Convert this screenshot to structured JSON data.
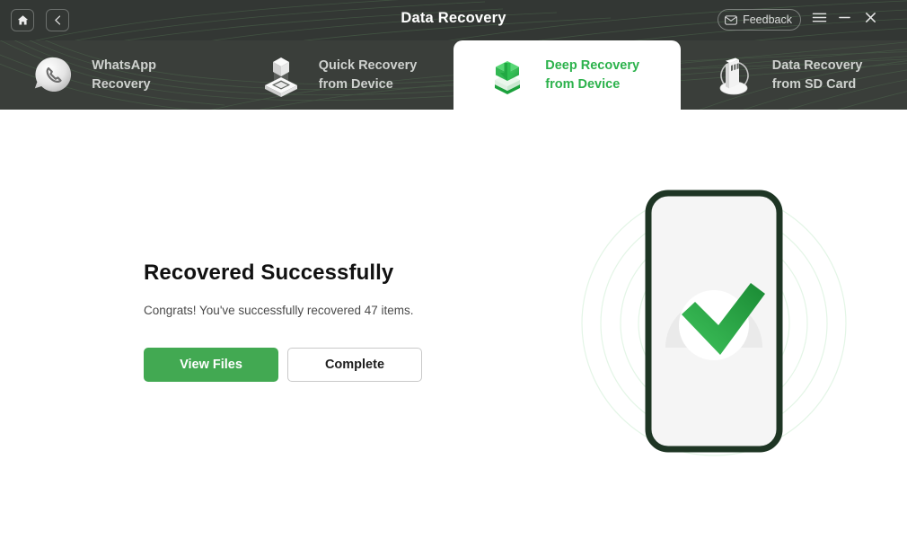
{
  "window": {
    "title": "Data Recovery",
    "home_icon": "home-icon",
    "back_icon": "chevron-left-icon",
    "feedback_label": "Feedback",
    "feedback_icon": "envelope-icon",
    "menu_icon": "hamburger-menu-icon",
    "minimize_icon": "minimize-icon",
    "close_icon": "close-icon"
  },
  "tabs": [
    {
      "id": "whatsapp-recovery",
      "label": "WhatsApp\nRecovery",
      "icon": "whatsapp-bubble-icon",
      "active": false
    },
    {
      "id": "quick-recovery-from-device",
      "label": "Quick Recovery\nfrom Device",
      "icon": "cube-platform-icon",
      "active": false
    },
    {
      "id": "deep-recovery-from-device",
      "label": "Deep Recovery\nfrom Device",
      "icon": "green-box-download-icon",
      "active": true
    },
    {
      "id": "data-recovery-from-sd-card",
      "label": "Data Recovery\nfrom SD Card",
      "icon": "sd-card-icon",
      "active": false
    }
  ],
  "main": {
    "headline": "Recovered Successfully",
    "subtext": "Congrats! You've successfully recovered 47 items.",
    "recovered_count": "47",
    "primary_button": "View Files",
    "secondary_button": "Complete",
    "illustration": "phone-with-green-checkmark"
  },
  "colors": {
    "accent_green": "#42a952",
    "check_green": "#2cb24c",
    "titlebar": "#333734",
    "navbar": "#3a3e3a",
    "phone_border": "#1e3524",
    "phone_screen": "#f5f5f5"
  }
}
